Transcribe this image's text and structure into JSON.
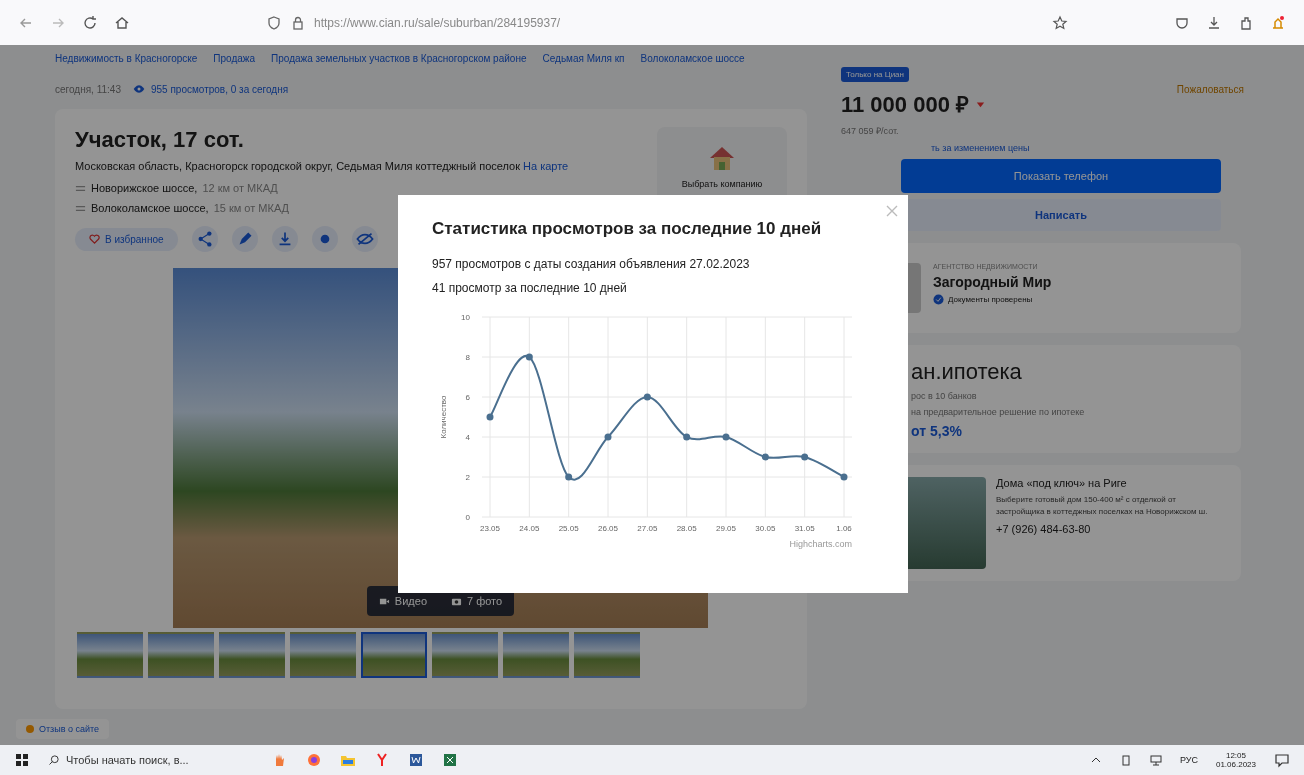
{
  "browser": {
    "url": "https://www.cian.ru/sale/suburban/284195937/"
  },
  "breadcrumbs": [
    "Недвижимость в Красногорске",
    "Продажа",
    "Продажа земельных участков в Красногорском районе",
    "Седьмая Миля кп",
    "Волоколамское шоссе"
  ],
  "meta": {
    "published": "сегодня, 11:43",
    "views": "955 просмотров, 0 за сегодня",
    "complaint": "Пожаловаться"
  },
  "listing": {
    "title": "Участок, 17 сот.",
    "address": "Московская область, Красногорск городской округ, Седьмая Миля коттеджный поселок",
    "map_link": "На карте",
    "highways": [
      {
        "name": "Новорижское шоссе,",
        "distance": "12 км от МКАД"
      },
      {
        "name": "Волоколамское шоссе,",
        "distance": "15 км от МКАД"
      }
    ],
    "favorite_button": "В избранное",
    "company_button": "Выбрать компанию"
  },
  "gallery": {
    "video_button": "Видео",
    "photos_button": "7 фото",
    "thumbnails": [
      {
        "selected": false
      },
      {
        "selected": false
      },
      {
        "selected": false
      },
      {
        "selected": false
      },
      {
        "selected": true
      },
      {
        "selected": false
      },
      {
        "selected": false
      },
      {
        "selected": false
      }
    ]
  },
  "feedback_button": "Отзыв о сайте",
  "offer": {
    "badge": "Только на Циан",
    "price": "11 000 000 ₽",
    "price_per_area": "647 059 ₽/сот.",
    "price_watch": "ть за изменением цены",
    "phone_button": "Показать телефон",
    "message_button": "Написать"
  },
  "agent": {
    "type": "АГЕНТСТВО НЕДВИЖИМОСТИ",
    "name": "Загородный Мир",
    "verified": "Документы проверены"
  },
  "mortgage": {
    "brand": "ан.ипотека",
    "line1": "рос в 10 банков",
    "line2": "на предварительное решение по ипотеке",
    "rate": "от 5,3%"
  },
  "ad": {
    "title": "Дома «под ключ» на Риге",
    "text": "Выберите готовый дом 150-400 м² с отделкой от застройщика в коттеджных поселках на Новорижском ш.",
    "phone": "+7 (926) 484-63-80"
  },
  "modal": {
    "title": "Статистика просмотров за последние 10 дней",
    "lines": [
      "957 просмотров с даты создания объявления 27.02.2023",
      "41 просмотр за последние 10 дней"
    ],
    "credit": "Highcharts.com",
    "chart_data": {
      "type": "line",
      "ylabel": "Количество",
      "categories": [
        "23.05",
        "24.05",
        "25.05",
        "26.05",
        "27.05",
        "28.05",
        "29.05",
        "30.05",
        "31.05",
        "1.06"
      ],
      "series": [
        {
          "color": "#4a6f8f",
          "marker": true,
          "values": [
            5,
            8,
            2,
            4,
            6,
            4,
            4,
            3,
            3,
            2
          ]
        }
      ],
      "grid": true,
      "ylim": [
        0,
        10
      ],
      "yticks": [
        0,
        2,
        4,
        6,
        8,
        10
      ]
    }
  },
  "taskbar": {
    "search_placeholder": "Чтобы начать поиск, в...",
    "language": "РУС",
    "time": "12:05",
    "date": "01.06.2023"
  }
}
